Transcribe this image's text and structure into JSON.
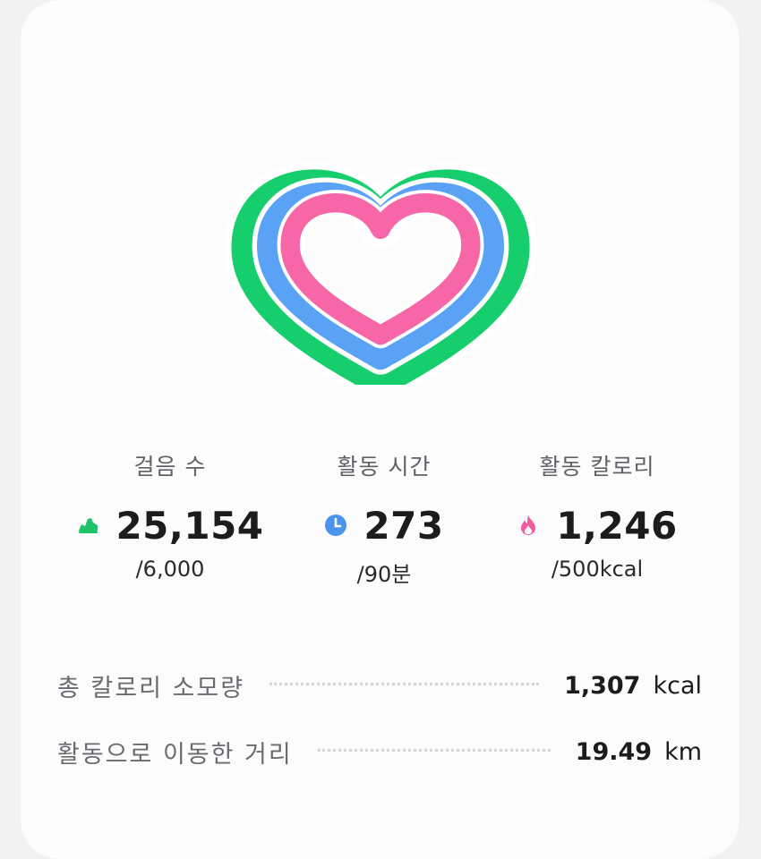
{
  "colors": {
    "steps_ring": "#16cf6c",
    "time_ring": "#5aa2f5",
    "calorie_ring": "#f766a6",
    "steps_icon": "#1fc36a",
    "time_icon": "#4a94ee",
    "calorie_icon": "#f25c9e"
  },
  "metrics": [
    {
      "label": "걸음 수",
      "value": "25,154",
      "goal": "/6,000",
      "icon": "shoe-icon"
    },
    {
      "label": "활동 시간",
      "value": "273",
      "goal": "/90분",
      "icon": "clock-icon"
    },
    {
      "label": "활동 칼로리",
      "value": "1,246",
      "goal": "/500kcal",
      "icon": "flame-icon"
    }
  ],
  "summary": [
    {
      "label": "총 칼로리 소모량",
      "value": "1,307",
      "unit": "kcal"
    },
    {
      "label": "활동으로 이동한 거리",
      "value": "19.49",
      "unit": "km"
    }
  ]
}
